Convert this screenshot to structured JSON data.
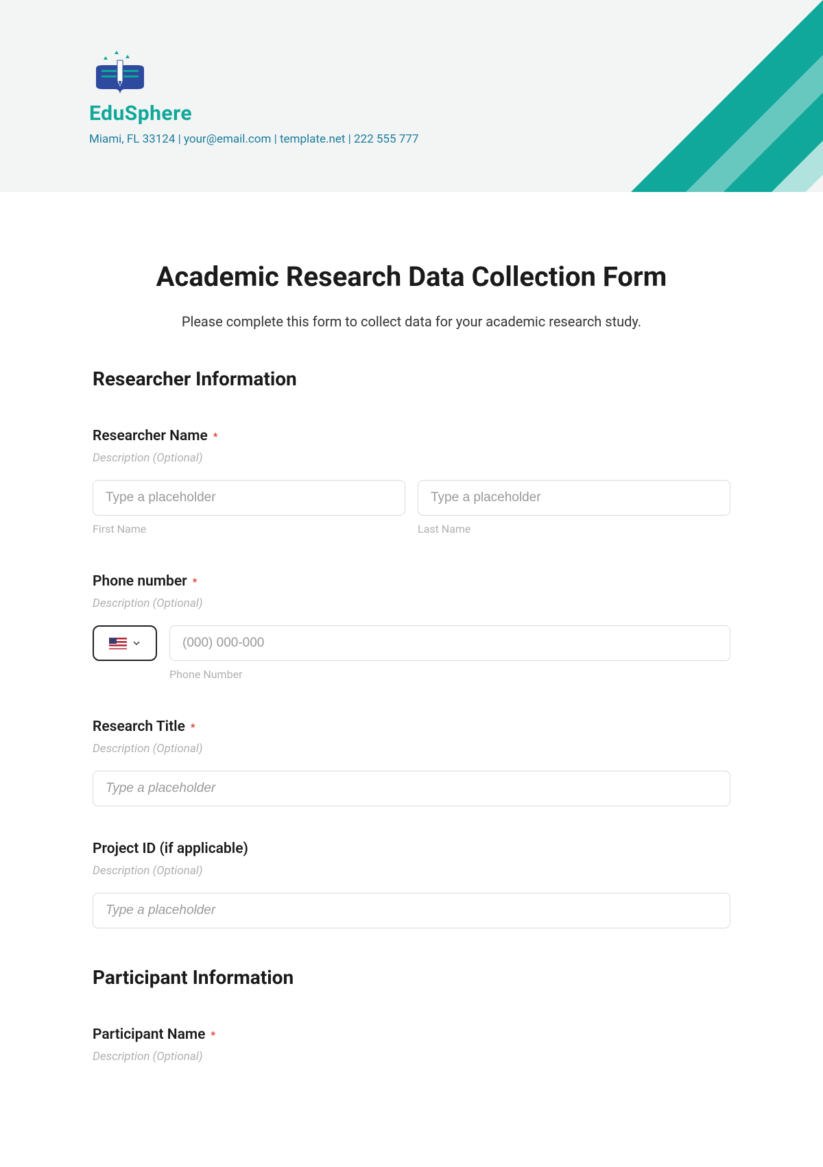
{
  "brand": {
    "name": "EduSphere",
    "contact": "Miami, FL 33124 | your@email.com | template.net | 222 555 777"
  },
  "form": {
    "title": "Academic Research Data Collection Form",
    "subtitle": "Please complete this form to collect data for your academic research study."
  },
  "sections": {
    "researcher": "Researcher Information",
    "participant": "Participant Information"
  },
  "fields": {
    "researcher_name": {
      "label": "Researcher Name",
      "required": "*",
      "desc": "Description (Optional)",
      "first_ph": "Type a placeholder",
      "last_ph": "Type a placeholder",
      "first_sub": "First Name",
      "last_sub": "Last Name"
    },
    "phone": {
      "label": "Phone number",
      "required": "*",
      "desc": "Description (Optional)",
      "ph": "(000) 000-000",
      "sub": "Phone Number"
    },
    "research_title": {
      "label": "Research Title",
      "required": "*",
      "desc": "Description (Optional)",
      "ph": "Type a placeholder"
    },
    "project_id": {
      "label": "Project ID (if applicable)",
      "desc": "Description (Optional)",
      "ph": "Type a placeholder"
    },
    "participant_name": {
      "label": "Participant Name",
      "required": "*",
      "desc": "Description (Optional)"
    }
  }
}
